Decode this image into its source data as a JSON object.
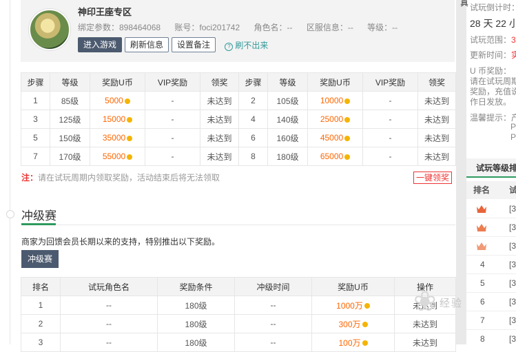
{
  "profile": {
    "title": "神印王座专区",
    "bind_param": "绑定参数：898464068",
    "account": "账号：foci201742",
    "role_name": "角色名：--",
    "region": "区服信息：--",
    "level": "等级：--",
    "buttons": {
      "enter_game": "进入游戏",
      "refresh": "刷新信息",
      "set_note": "设置备注"
    },
    "help_text": "刷不出来"
  },
  "reward_table": {
    "headers": [
      "步骤",
      "等级",
      "奖励U币",
      "VIP奖励",
      "领奖",
      "步骤",
      "等级",
      "奖励U币",
      "VIP奖励",
      "领奖"
    ],
    "rows": [
      [
        "1",
        "85级",
        "5000",
        "-",
        "未达到",
        "2",
        "105级",
        "10000",
        "-",
        "未达到"
      ],
      [
        "3",
        "125级",
        "15000",
        "-",
        "未达到",
        "4",
        "140级",
        "25000",
        "-",
        "未达到"
      ],
      [
        "5",
        "150级",
        "35000",
        "-",
        "未达到",
        "6",
        "160级",
        "45000",
        "-",
        "未达到"
      ],
      [
        "7",
        "170级",
        "55000",
        "-",
        "未达到",
        "8",
        "180级",
        "65000",
        "-",
        "未达到"
      ]
    ]
  },
  "note": {
    "label": "注：",
    "text": "请在试玩周期内领取奖励，活动结束后将无法领取"
  },
  "claim_all": "一键领奖",
  "rush": {
    "title": "冲级赛",
    "desc": "商家为回馈会员长期以来的支持，特别推出以下奖励。",
    "button": "冲级赛",
    "headers": [
      "排名",
      "试玩角色名",
      "奖励条件",
      "冲级时间",
      "奖励U币",
      "操作"
    ],
    "rows": [
      [
        "1",
        "--",
        "180级",
        "--",
        "1000万",
        "未达到"
      ],
      [
        "2",
        "--",
        "180级",
        "--",
        "300万",
        "未达到"
      ],
      [
        "3",
        "--",
        "180级",
        "--",
        "100万",
        "未达到"
      ]
    ]
  },
  "edge_text": "真",
  "sidebar": {
    "lines": [
      {
        "label": "试玩倒计时：",
        "value": ""
      },
      {
        "label": "28 天 22 小",
        "value": ""
      },
      {
        "label": "试玩范围：",
        "value": "3"
      },
      {
        "label": "更新时间：",
        "value": "实"
      },
      {
        "label": "U 币奖励：",
        "value": ""
      },
      {
        "label": "请在试玩周期",
        "value": ""
      },
      {
        "label": "奖励，充值说",
        "value": ""
      },
      {
        "label": "作日发放。",
        "value": ""
      },
      {
        "label": "温馨提示：产",
        "value": ""
      },
      {
        "label": "P",
        "value": ""
      },
      {
        "label": "P",
        "value": ""
      }
    ],
    "rank_head": "试玩等级排",
    "rank_cols": [
      "排名",
      "试"
    ],
    "rank_rows": [
      {
        "rank": "",
        "name": "[3"
      },
      {
        "rank": "",
        "name": "[3"
      },
      {
        "rank": "",
        "name": "[3"
      },
      {
        "rank": "4",
        "name": "[3"
      },
      {
        "rank": "5",
        "name": "[3"
      },
      {
        "rank": "6",
        "name": "[3"
      },
      {
        "rank": "7",
        "name": "[3"
      },
      {
        "rank": "8",
        "name": "[3"
      }
    ]
  },
  "watermark": "经验",
  "colors": {
    "accent_green": "#2e9a5e",
    "coin_orange": "#ff6600",
    "warning_red": "#e33",
    "dark_button": "#4c5a6f"
  }
}
